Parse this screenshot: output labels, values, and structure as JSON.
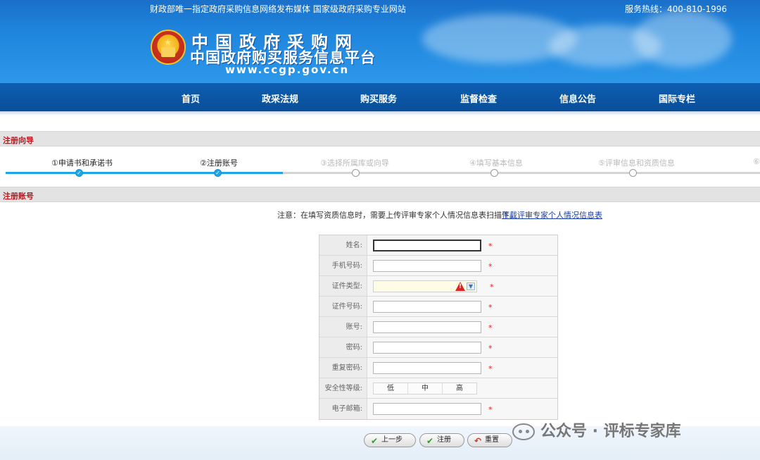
{
  "header": {
    "tagline": "财政部唯一指定政府采购信息网络发布媒体 国家级政府采购专业网站",
    "hotline": "服务热线：400-810-1996",
    "site_title": "中国政府采购网",
    "site_subtitle": "中国政府购买服务信息平台",
    "site_url": "www.ccgp.gov.cn"
  },
  "nav": {
    "items": [
      {
        "label": "首页"
      },
      {
        "label": "政采法规"
      },
      {
        "label": "购买服务"
      },
      {
        "label": "监督检查"
      },
      {
        "label": "信息公告"
      },
      {
        "label": "国际专栏"
      }
    ]
  },
  "wizard": {
    "section_title": "注册向导",
    "steps": [
      {
        "label": "①申请书和承诺书",
        "status": "done"
      },
      {
        "label": "②注册账号",
        "status": "done"
      },
      {
        "label": "③选择所属库或向导",
        "status": "todo"
      },
      {
        "label": "④填写基本信息",
        "status": "todo"
      },
      {
        "label": "⑤评审信息和资质信息",
        "status": "todo"
      },
      {
        "label": "⑥",
        "status": "todo"
      }
    ]
  },
  "register": {
    "section_title": "注册账号",
    "notice": "注意：在填写资质信息时，需要上传评审专家个人情况信息表扫描件。",
    "download_link": "下载评审专家个人情况信息表",
    "fields": [
      {
        "label": "姓名:",
        "value": "",
        "required": "*"
      },
      {
        "label": "手机号码:",
        "value": "",
        "required": "*"
      },
      {
        "label": "证件类型:",
        "value": "",
        "required": "*"
      },
      {
        "label": "证件号码:",
        "value": "",
        "required": "*"
      },
      {
        "label": "账号:",
        "value": "",
        "required": "*"
      },
      {
        "label": "密码:",
        "value": "",
        "required": "*"
      },
      {
        "label": "重复密码:",
        "value": "",
        "required": "*"
      },
      {
        "label": "安全性等级:"
      },
      {
        "label": "电子邮箱:",
        "value": "",
        "required": "*"
      }
    ],
    "strength_levels": [
      "低",
      "中",
      "高"
    ]
  },
  "buttons": {
    "prev": "上一步",
    "register": "注册",
    "reset": "重置"
  },
  "watermark": {
    "text": "公众号 · 评标专家库"
  },
  "colors": {
    "accent_red": "#c0141c",
    "step_active": "#1da5e6",
    "nav_bg": "#0a4e98"
  }
}
